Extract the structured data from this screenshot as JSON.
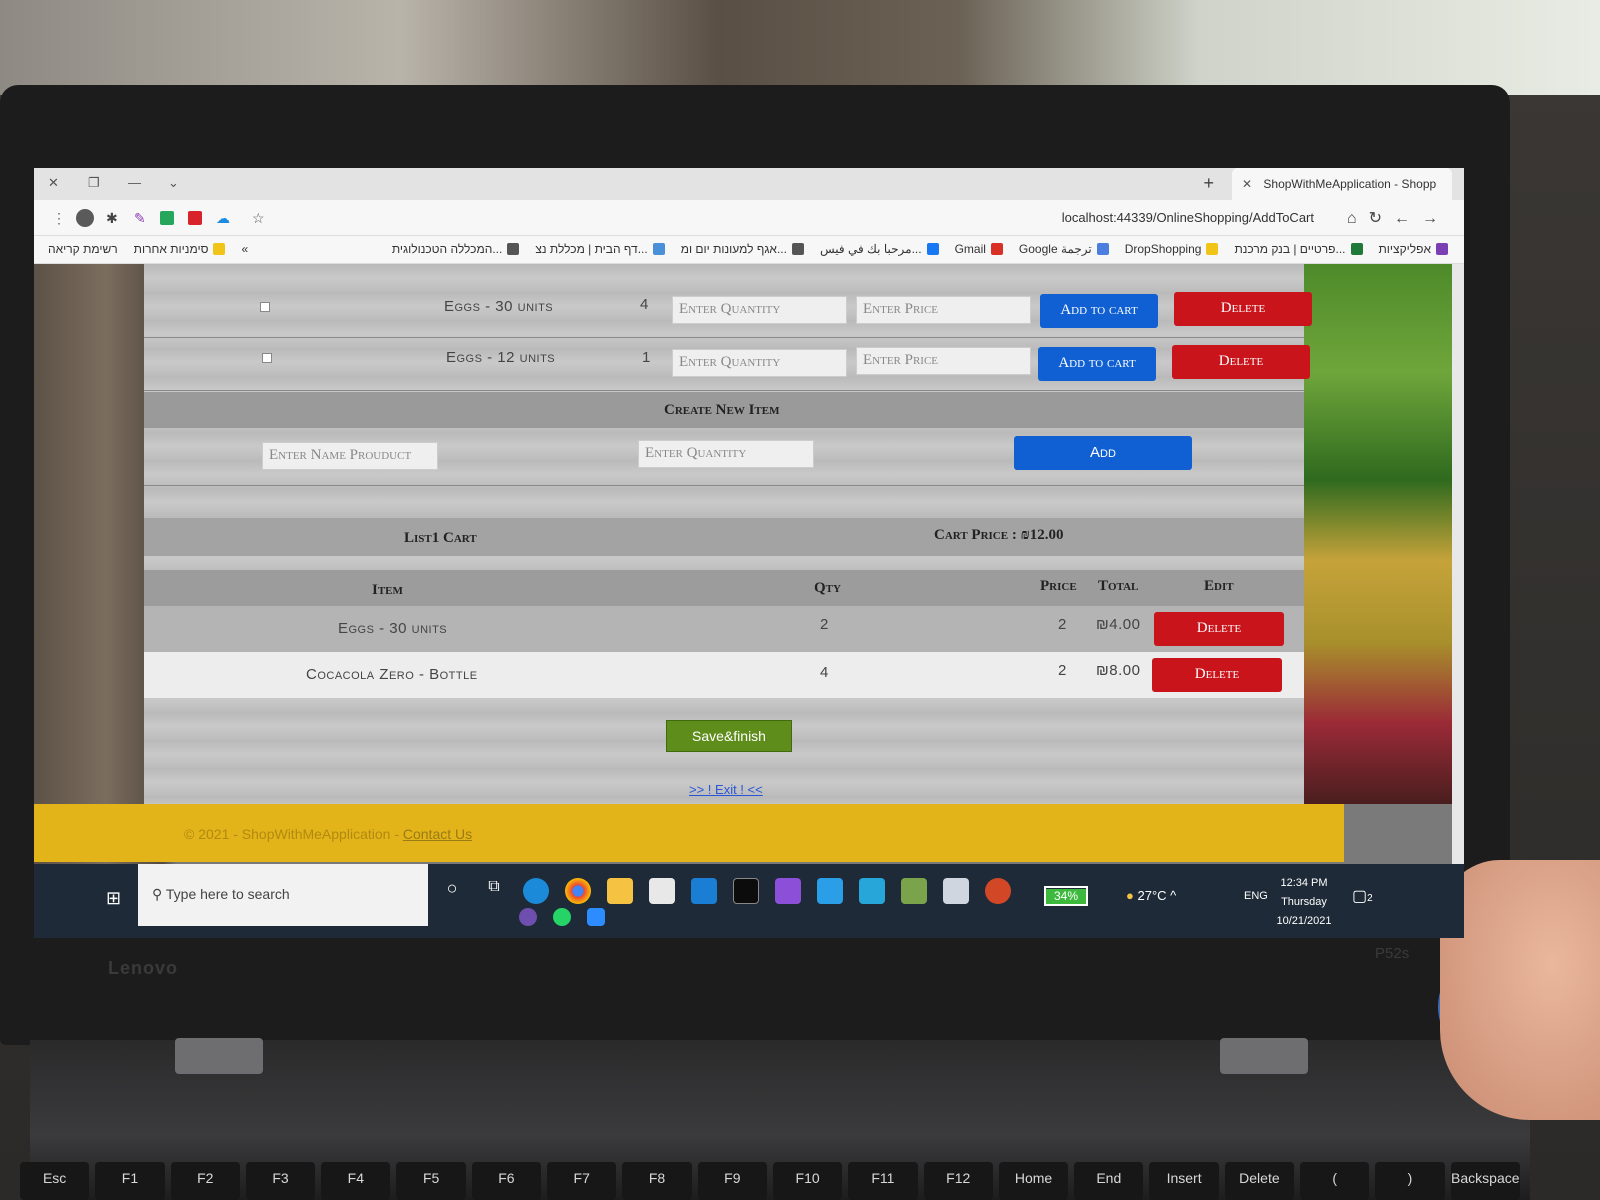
{
  "browser": {
    "tab_title": "ShopWithMeApplication - Shopp",
    "new_tab": "+",
    "url": "localhost:44339/OnlineShopping/AddToCart",
    "bookmarks_right": [
      "אפליקציות",
      "פרטיים | בנק מרכנת...",
      "DropShopping",
      "Google ترجمة",
      "Gmail",
      "مرحبا بك في فيس...",
      "אגף למעונות יום ומ...",
      "דף הבית | מכללת נצ...",
      "המכללה הטכנולוגית..."
    ],
    "bookmarks_left": [
      "רשימת קריאה",
      "סימניות אחרות",
      "«"
    ]
  },
  "items": [
    {
      "name": "Eggs - 30 units",
      "qty": "4",
      "qty_placeholder": "Enter Quantity",
      "price_placeholder": "Enter Price",
      "add_label": "Add to cart",
      "delete_label": "Delete"
    },
    {
      "name": "Eggs - 12 units",
      "qty": "1",
      "qty_placeholder": "Enter Quantity",
      "price_placeholder": "Enter Price",
      "add_label": "Add to cart",
      "delete_label": "Delete"
    }
  ],
  "create_item": {
    "title": "Create New Item",
    "name_placeholder": "Enter Name Prouduct",
    "qty_placeholder": "Enter Quantity",
    "add_label": "Add"
  },
  "cart": {
    "title": "List1 Cart",
    "price_label": "Cart Price : ₪12.00",
    "columns": {
      "item": "Item",
      "qty": "Qty",
      "price": "Price",
      "total": "Total",
      "edit": "Edit"
    },
    "rows": [
      {
        "item": "Eggs - 30 units",
        "qty": "2",
        "price": "2",
        "total": "₪4.00",
        "delete": "Delete"
      },
      {
        "item": "Cocacola Zero - Bottle",
        "qty": "4",
        "price": "2",
        "total": "₪8.00",
        "delete": "Delete"
      }
    ],
    "save_label": "Save&finish",
    "exit_label": ">> ! Exit ! <<"
  },
  "footer": {
    "copyright": "© 2021 - ShopWithMeApplication -",
    "contact": "Contact Us"
  },
  "taskbar": {
    "search_placeholder": "Type here to search",
    "battery": "34%",
    "weather": "27°C",
    "lang": "ENG",
    "time": "12:34 PM",
    "day": "Thursday",
    "date": "10/21/2021",
    "notifications": "2"
  },
  "hardware": {
    "brand": "Lenovo",
    "model": "P52s",
    "keys": [
      "Esc",
      "F1",
      "F2",
      "F3",
      "F4",
      "F5",
      "F6",
      "F7",
      "F8",
      "F9",
      "F10",
      "F11",
      "F12",
      "Home",
      "End",
      "Insert",
      "Delete",
      "(",
      ")",
      "Backspace"
    ]
  },
  "colors": {
    "blue_button": "#1160d3",
    "red_button": "#c9141c",
    "save_button": "#5f8d1c",
    "footer": "#e3b31a"
  }
}
